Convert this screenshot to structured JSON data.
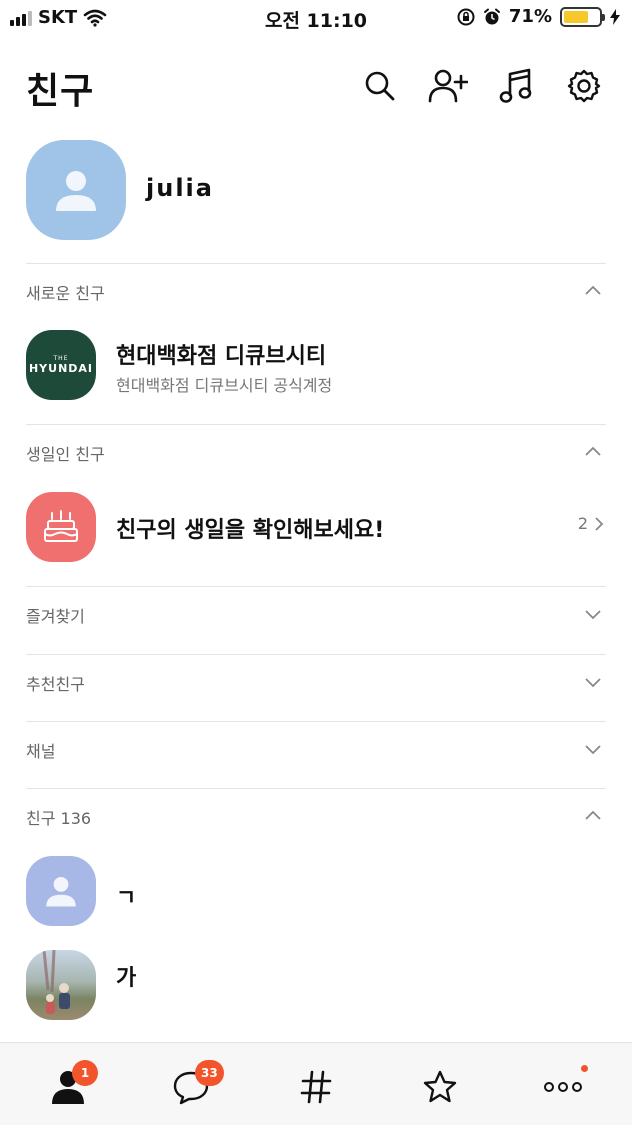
{
  "status_bar": {
    "carrier": "SKT",
    "time": "오전 11:10",
    "battery_percent": "71%",
    "battery_level": 0.71,
    "icons": [
      "signal-icon",
      "wifi-icon",
      "orientation-lock-icon",
      "alarm-icon",
      "battery-icon",
      "charging-icon"
    ]
  },
  "header": {
    "title": "친구",
    "icons": [
      "search-icon",
      "add-friend-icon",
      "music-icon",
      "settings-icon"
    ]
  },
  "my_profile": {
    "name": "julia"
  },
  "sections": {
    "new_friends": {
      "label": "새로운 친구",
      "item": {
        "logo_small": "THE",
        "logo_big": "HYUNDAI",
        "name": "현대백화점 디큐브시티",
        "status": "현대백화점 디큐브시티 공식계정"
      }
    },
    "birthday": {
      "label": "생일인 친구",
      "item": {
        "text": "친구의 생일을 확인해보세요!",
        "count": "2"
      }
    },
    "favorites": {
      "label": "즐겨찾기"
    },
    "recommended": {
      "label": "추천친구"
    },
    "channel": {
      "label": "채널"
    },
    "friends": {
      "label": "친구 136",
      "items": [
        {
          "name": "ㄱ"
        },
        {
          "name": "가"
        }
      ]
    }
  },
  "tabbar": {
    "tabs": [
      {
        "name": "friends-tab",
        "badge": "1"
      },
      {
        "name": "chats-tab",
        "badge": "33"
      },
      {
        "name": "hashtag-tab"
      },
      {
        "name": "shopping-tab"
      },
      {
        "name": "more-tab"
      }
    ],
    "accent_color": "#f2552c"
  }
}
